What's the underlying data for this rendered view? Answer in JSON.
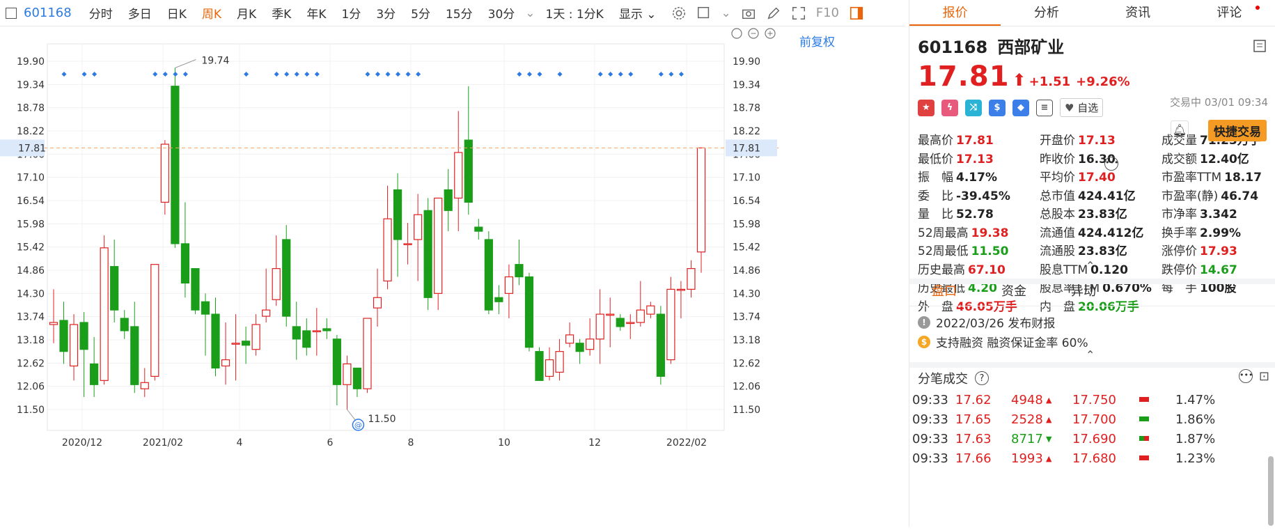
{
  "toolbar": {
    "code": "601168",
    "periods": [
      "分时",
      "多日",
      "日K",
      "周K",
      "月K",
      "季K",
      "年K",
      "1分",
      "3分",
      "5分",
      "15分",
      "30分"
    ],
    "active_period": "周K",
    "interval": "1天 : 1分K",
    "display": "显示",
    "f10": "F10"
  },
  "chart": {
    "adjust_label": "前复权",
    "y_labels": [
      "19.90",
      "19.34",
      "18.78",
      "18.22",
      "17.66",
      "17.10",
      "16.54",
      "15.98",
      "15.42",
      "14.86",
      "14.30",
      "13.74",
      "13.18",
      "12.62",
      "12.06",
      "11.50"
    ],
    "current_price_label": "17.81",
    "x_labels": [
      "2020/12",
      "2021/02",
      "4",
      "6",
      "8",
      "10",
      "12",
      "2022/02"
    ],
    "high_annotation": "19.74",
    "low_annotation": "11.50",
    "colors": {
      "up": "#e02020",
      "down": "#1a9e1a",
      "accent": "#2b7be3",
      "price_line": "#f4a460"
    }
  },
  "chart_data": {
    "type": "candlestick",
    "ylim": [
      11.2,
      20.2
    ],
    "candles": [
      [
        13.55,
        13.6,
        14.4,
        13.1
      ],
      [
        13.65,
        12.9,
        14.1,
        12.6
      ],
      [
        12.55,
        13.55,
        13.8,
        12.2
      ],
      [
        13.6,
        12.95,
        13.85,
        11.8
      ],
      [
        12.6,
        12.1,
        13.25,
        11.8
      ],
      [
        12.2,
        15.4,
        15.7,
        12.1
      ],
      [
        14.95,
        13.9,
        15.6,
        13.6
      ],
      [
        13.7,
        13.4,
        13.9,
        13.2
      ],
      [
        13.5,
        12.1,
        14.1,
        11.9
      ],
      [
        12.0,
        12.15,
        12.5,
        11.8
      ],
      [
        12.3,
        15.0,
        15.0,
        12.2
      ],
      [
        16.5,
        17.9,
        18.0,
        16.2
      ],
      [
        19.3,
        15.5,
        19.74,
        15.4
      ],
      [
        15.5,
        14.55,
        16.5,
        14.2
      ],
      [
        14.9,
        13.9,
        14.9,
        13.8
      ],
      [
        14.1,
        13.8,
        14.3,
        12.8
      ],
      [
        13.8,
        12.5,
        14.2,
        12.3
      ],
      [
        12.55,
        12.7,
        13.6,
        12.1
      ],
      [
        13.1,
        13.1,
        13.8,
        12.2
      ],
      [
        13.15,
        13.05,
        13.5,
        12.6
      ],
      [
        12.95,
        13.55,
        13.8,
        12.8
      ],
      [
        13.75,
        13.9,
        14.9,
        13.6
      ],
      [
        14.15,
        14.9,
        15.7,
        14.0
      ],
      [
        15.6,
        13.75,
        15.95,
        13.5
      ],
      [
        13.5,
        13.2,
        14.1,
        12.7
      ],
      [
        13.4,
        13.0,
        13.7,
        12.8
      ],
      [
        13.4,
        13.4,
        13.95,
        12.8
      ],
      [
        13.45,
        13.4,
        13.7,
        13.2
      ],
      [
        13.2,
        12.1,
        13.3,
        11.6
      ],
      [
        12.1,
        12.6,
        12.8,
        11.5
      ],
      [
        12.5,
        12.0,
        12.5,
        11.8
      ],
      [
        12.0,
        13.7,
        13.7,
        11.9
      ],
      [
        13.95,
        14.2,
        14.9,
        13.5
      ],
      [
        14.6,
        16.1,
        16.9,
        14.4
      ],
      [
        16.8,
        15.6,
        17.2,
        14.7
      ],
      [
        15.5,
        15.5,
        16.0,
        15.0
      ],
      [
        15.6,
        16.2,
        16.7,
        14.6
      ],
      [
        16.3,
        14.2,
        16.6,
        13.9
      ],
      [
        14.3,
        16.6,
        16.6,
        13.9
      ],
      [
        16.8,
        16.3,
        17.3,
        15.8
      ],
      [
        16.6,
        17.7,
        18.7,
        15.8
      ],
      [
        18.0,
        16.5,
        19.3,
        16.2
      ],
      [
        15.9,
        15.8,
        16.1,
        15.6
      ],
      [
        15.6,
        13.9,
        15.8,
        13.8
      ],
      [
        14.2,
        14.1,
        14.5,
        13.8
      ],
      [
        14.3,
        14.7,
        15.0,
        13.7
      ],
      [
        15.0,
        14.7,
        15.6,
        14.5
      ],
      [
        14.7,
        13.0,
        14.8,
        12.9
      ],
      [
        12.9,
        12.2,
        13.0,
        12.2
      ],
      [
        12.3,
        12.7,
        13.0,
        12.2
      ],
      [
        12.4,
        12.9,
        13.2,
        12.2
      ],
      [
        13.1,
        13.3,
        13.6,
        13.0
      ],
      [
        13.1,
        12.9,
        13.2,
        12.6
      ],
      [
        12.95,
        13.2,
        13.7,
        12.8
      ],
      [
        13.2,
        13.8,
        14.4,
        12.6
      ],
      [
        13.8,
        13.8,
        14.2,
        13.0
      ],
      [
        13.7,
        13.5,
        13.8,
        13.4
      ],
      [
        13.6,
        13.6,
        13.8,
        13.2
      ],
      [
        13.6,
        13.9,
        14.6,
        13.5
      ],
      [
        13.8,
        14.0,
        14.1,
        13.7
      ],
      [
        13.8,
        12.3,
        14.0,
        12.1
      ],
      [
        12.7,
        14.4,
        14.7,
        12.6
      ],
      [
        14.4,
        14.4,
        14.6,
        13.7
      ],
      [
        14.4,
        14.9,
        15.1,
        14.2
      ],
      [
        15.3,
        17.81,
        17.81,
        14.8
      ]
    ],
    "last_price": 17.81
  },
  "quote": {
    "code": "601168",
    "name": "西部矿业",
    "price": "17.81",
    "change": "+1.51",
    "pct": "+9.26%",
    "status": "交易中 03/01 09:34",
    "zixuan": "自选",
    "quick_trade": "快捷交易",
    "fields": [
      {
        "label": "最高价",
        "value": "17.81",
        "color": "red"
      },
      {
        "label": "开盘价",
        "value": "17.13",
        "color": "red"
      },
      {
        "label": "成交量",
        "value": "71.23万手",
        "color": "dark"
      },
      {
        "label": "最低价",
        "value": "17.13",
        "color": "red"
      },
      {
        "label": "昨收价",
        "value": "16.30",
        "color": "dark"
      },
      {
        "label": "成交额",
        "value": "12.40亿",
        "color": "dark"
      },
      {
        "label": "振　幅",
        "value": "4.17%",
        "color": "dark"
      },
      {
        "label": "平均价",
        "value": "17.40",
        "color": "red"
      },
      {
        "label": "市盈率TTM",
        "value": "18.17",
        "color": "dark"
      },
      {
        "label": "委　比",
        "value": "-39.45%",
        "color": "dark"
      },
      {
        "label": "总市值",
        "value": "424.41亿",
        "color": "dark"
      },
      {
        "label": "市盈率(静)",
        "value": "46.74",
        "color": "dark"
      },
      {
        "label": "量　比",
        "value": "52.78",
        "color": "dark"
      },
      {
        "label": "总股本",
        "value": "23.83亿",
        "color": "dark"
      },
      {
        "label": "市净率",
        "value": "3.342",
        "color": "dark"
      },
      {
        "label": "52周最高",
        "value": "19.38",
        "color": "red"
      },
      {
        "label": "流通值",
        "value": "424.412亿",
        "color": "dark"
      },
      {
        "label": "换手率",
        "value": "2.99%",
        "color": "dark"
      },
      {
        "label": "52周最低",
        "value": "11.50",
        "color": "green"
      },
      {
        "label": "流通股",
        "value": "23.83亿",
        "color": "dark"
      },
      {
        "label": "涨停价",
        "value": "17.93",
        "color": "red"
      },
      {
        "label": "历史最高",
        "value": "67.10",
        "color": "red"
      },
      {
        "label": "股息TTM",
        "value": "0.120",
        "color": "dark"
      },
      {
        "label": "跌停价",
        "value": "14.67",
        "color": "green"
      },
      {
        "label": "历史最低",
        "value": "4.20",
        "color": "green"
      },
      {
        "label": "股息率TTM",
        "value": "0.670%",
        "color": "dark"
      },
      {
        "label": "每　手",
        "value": "100股",
        "color": "dark"
      },
      {
        "label": "外　盘",
        "value": "46.05万手",
        "color": "red"
      },
      {
        "label": "内　盘",
        "value": "20.06万手",
        "color": "green"
      },
      {
        "label": "",
        "value": "",
        "color": "dark"
      }
    ]
  },
  "right_tabs": [
    "报价",
    "分析",
    "资讯",
    "评论"
  ],
  "sub_tabs": [
    "盘口",
    "资金",
    "异动"
  ],
  "notices": [
    {
      "icon": "!",
      "text": "2022/03/26  发布财报",
      "color": "#999"
    },
    {
      "icon": "$",
      "text": "支持融资  融资保证金率 60%",
      "color": "#f5a623"
    }
  ],
  "ticks_title": "分笔成交",
  "ticks": [
    {
      "time": "09:33",
      "price": "17.62",
      "vol": "4948",
      "dir": "up",
      "px2": "17.750",
      "pct": "1.47%",
      "ind": "red"
    },
    {
      "time": "09:33",
      "price": "17.65",
      "vol": "2528",
      "dir": "up",
      "px2": "17.700",
      "pct": "1.86%",
      "ind": "green"
    },
    {
      "time": "09:33",
      "price": "17.63",
      "vol": "8717",
      "dir": "down",
      "px2": "17.690",
      "pct": "1.87%",
      "ind": "mixed"
    },
    {
      "time": "09:33",
      "price": "17.66",
      "vol": "1993",
      "dir": "up",
      "px2": "17.680",
      "pct": "1.23%",
      "ind": "red"
    }
  ]
}
